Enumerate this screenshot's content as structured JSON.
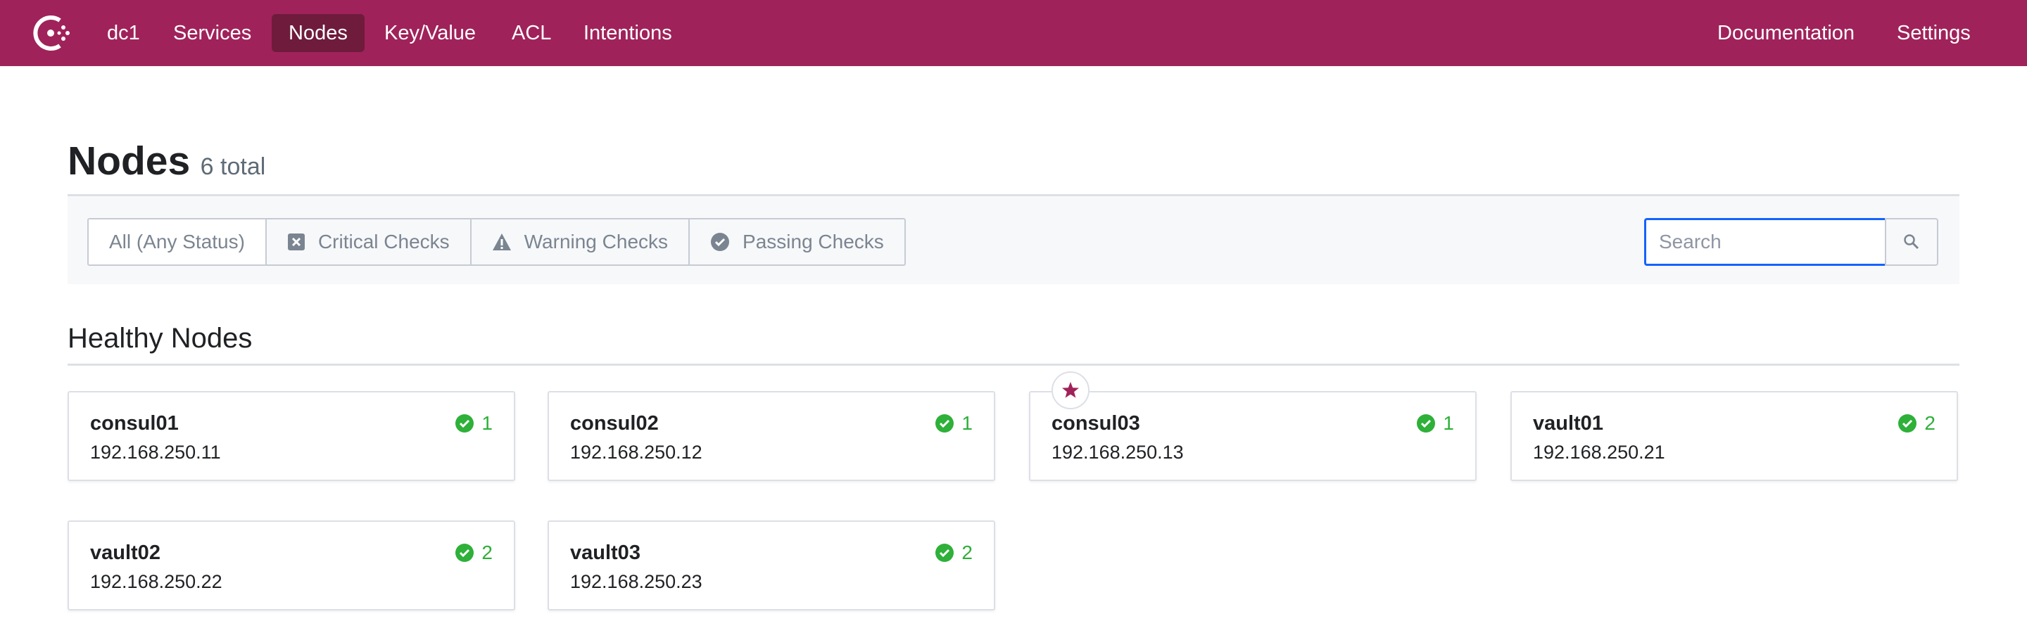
{
  "nav": {
    "datacenter": "dc1",
    "items": [
      {
        "label": "Services"
      },
      {
        "label": "Nodes"
      },
      {
        "label": "Key/Value"
      },
      {
        "label": "ACL"
      },
      {
        "label": "Intentions"
      }
    ],
    "right": [
      {
        "label": "Documentation"
      },
      {
        "label": "Settings"
      }
    ],
    "active": "Nodes",
    "brand_color": "#a0225a",
    "active_color": "#6e1b3c"
  },
  "page": {
    "title": "Nodes",
    "count": "6 total"
  },
  "filters": [
    {
      "label": "All (Any Status)",
      "icon": "none"
    },
    {
      "label": "Critical Checks",
      "icon": "critical-x-icon"
    },
    {
      "label": "Warning Checks",
      "icon": "warning-triangle-icon"
    },
    {
      "label": "Passing Checks",
      "icon": "passing-check-icon"
    }
  ],
  "search": {
    "placeholder": "Search",
    "value": ""
  },
  "section": {
    "title": "Healthy Nodes"
  },
  "nodes": [
    {
      "name": "consul01",
      "address": "192.168.250.11",
      "passing": "1",
      "leader": false
    },
    {
      "name": "consul02",
      "address": "192.168.250.12",
      "passing": "1",
      "leader": false
    },
    {
      "name": "consul03",
      "address": "192.168.250.13",
      "passing": "1",
      "leader": true
    },
    {
      "name": "vault01",
      "address": "192.168.250.21",
      "passing": "2",
      "leader": false
    },
    {
      "name": "vault02",
      "address": "192.168.250.22",
      "passing": "2",
      "leader": false
    },
    {
      "name": "vault03",
      "address": "192.168.250.23",
      "passing": "2",
      "leader": false
    }
  ],
  "colors": {
    "passing": "#2eb039",
    "accent": "#a0225a",
    "focus": "#1563ff"
  }
}
